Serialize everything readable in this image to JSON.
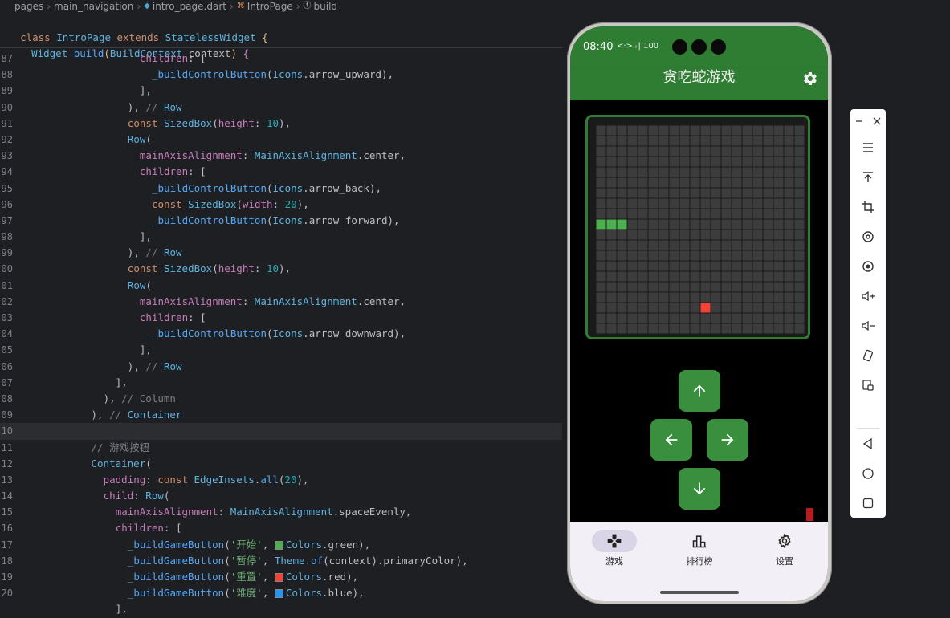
{
  "breadcrumb": {
    "items": [
      "pages",
      "main_navigation",
      "intro_page.dart",
      "IntroPage",
      "build"
    ],
    "icons": [
      "",
      "",
      "dart-file-icon",
      "widget-class-icon",
      "method-icon"
    ]
  },
  "sticky": {
    "line1": "  class IntroPage extends StatelessWidget {",
    "line2": "    Widget build(BuildContext context) {"
  },
  "code_lines": [
    {
      "n": "87",
      "t": "children: ["
    },
    {
      "n": "88",
      "t": "_buildControlButton(Icons.arrow_upward),"
    },
    {
      "n": "89",
      "t": "],"
    },
    {
      "n": "90",
      "t": "), // Row"
    },
    {
      "n": "91",
      "t": "const SizedBox(height: 10),"
    },
    {
      "n": "92",
      "t": "Row("
    },
    {
      "n": "93",
      "t": "mainAxisAlignment: MainAxisAlignment.center,"
    },
    {
      "n": "94",
      "t": "children: ["
    },
    {
      "n": "95",
      "t": "_buildControlButton(Icons.arrow_back),"
    },
    {
      "n": "96",
      "t": "const SizedBox(width: 20),"
    },
    {
      "n": "97",
      "t": "_buildControlButton(Icons.arrow_forward),"
    },
    {
      "n": "98",
      "t": "],"
    },
    {
      "n": "99",
      "t": "), // Row"
    },
    {
      "n": "00",
      "t": "const SizedBox(height: 10),"
    },
    {
      "n": "01",
      "t": "Row("
    },
    {
      "n": "02",
      "t": "mainAxisAlignment: MainAxisAlignment.center,"
    },
    {
      "n": "03",
      "t": "children: ["
    },
    {
      "n": "04",
      "t": "_buildControlButton(Icons.arrow_downward),"
    },
    {
      "n": "05",
      "t": "],"
    },
    {
      "n": "06",
      "t": "), // Row"
    },
    {
      "n": "07",
      "t": "],"
    },
    {
      "n": "08",
      "t": "), // Column"
    },
    {
      "n": "09",
      "t": "), // Container"
    },
    {
      "n": "10",
      "t": ""
    },
    {
      "n": "11",
      "t": "// 游戏按钮"
    },
    {
      "n": "12",
      "t": "Container("
    },
    {
      "n": "13",
      "t": "padding: const EdgeInsets.all(20),"
    },
    {
      "n": "14",
      "t": "child: Row("
    },
    {
      "n": "15",
      "t": "mainAxisAlignment: MainAxisAlignment.spaceEvenly,"
    },
    {
      "n": "16",
      "t": "children: ["
    },
    {
      "n": "17",
      "t": "_buildGameButton('开始', Colors.green),"
    },
    {
      "n": "18",
      "t": "_buildGameButton('暂停', Theme.of(context).primaryColor),"
    },
    {
      "n": "19",
      "t": "_buildGameButton('重置', Colors.red),"
    },
    {
      "n": "20",
      "t": "_buildGameButton('难度', Colors.blue),"
    },
    {
      "n": "",
      "t": "],"
    }
  ],
  "colors": {
    "green": "#4caf50",
    "red": "#f44336",
    "blue": "#2196f3",
    "app_green": "#2e7d32"
  },
  "phone": {
    "status_time": "08:40",
    "status_icons": "<·> ᵢ‖ 100",
    "app_title": "贪吃蛇游戏",
    "settings_icon": "gear-icon",
    "board": {
      "cols": 20,
      "rows": 20,
      "snake_cells": [
        [
          0,
          9
        ],
        [
          1,
          9
        ],
        [
          2,
          9
        ]
      ],
      "food_cell": [
        10,
        17
      ]
    },
    "controls": [
      "arrow-up-icon",
      "arrow-left-icon",
      "arrow-right-icon",
      "arrow-down-icon"
    ],
    "nav": [
      {
        "label": "游戏",
        "icon": "gamepad-icon",
        "active": true
      },
      {
        "label": "排行榜",
        "icon": "leaderboard-icon",
        "active": false
      },
      {
        "label": "设置",
        "icon": "gear-icon",
        "active": false
      }
    ]
  },
  "toolbar": {
    "buttons": [
      "minimize-icon",
      "close-icon",
      "menu-icon",
      "pin-top-icon",
      "crop-icon",
      "rotate-left-icon",
      "rotate-right-icon",
      "volume-up-icon",
      "volume-down-icon",
      "shake-icon",
      "screenshot-icon",
      "back-icon",
      "home-icon",
      "recents-icon"
    ]
  }
}
